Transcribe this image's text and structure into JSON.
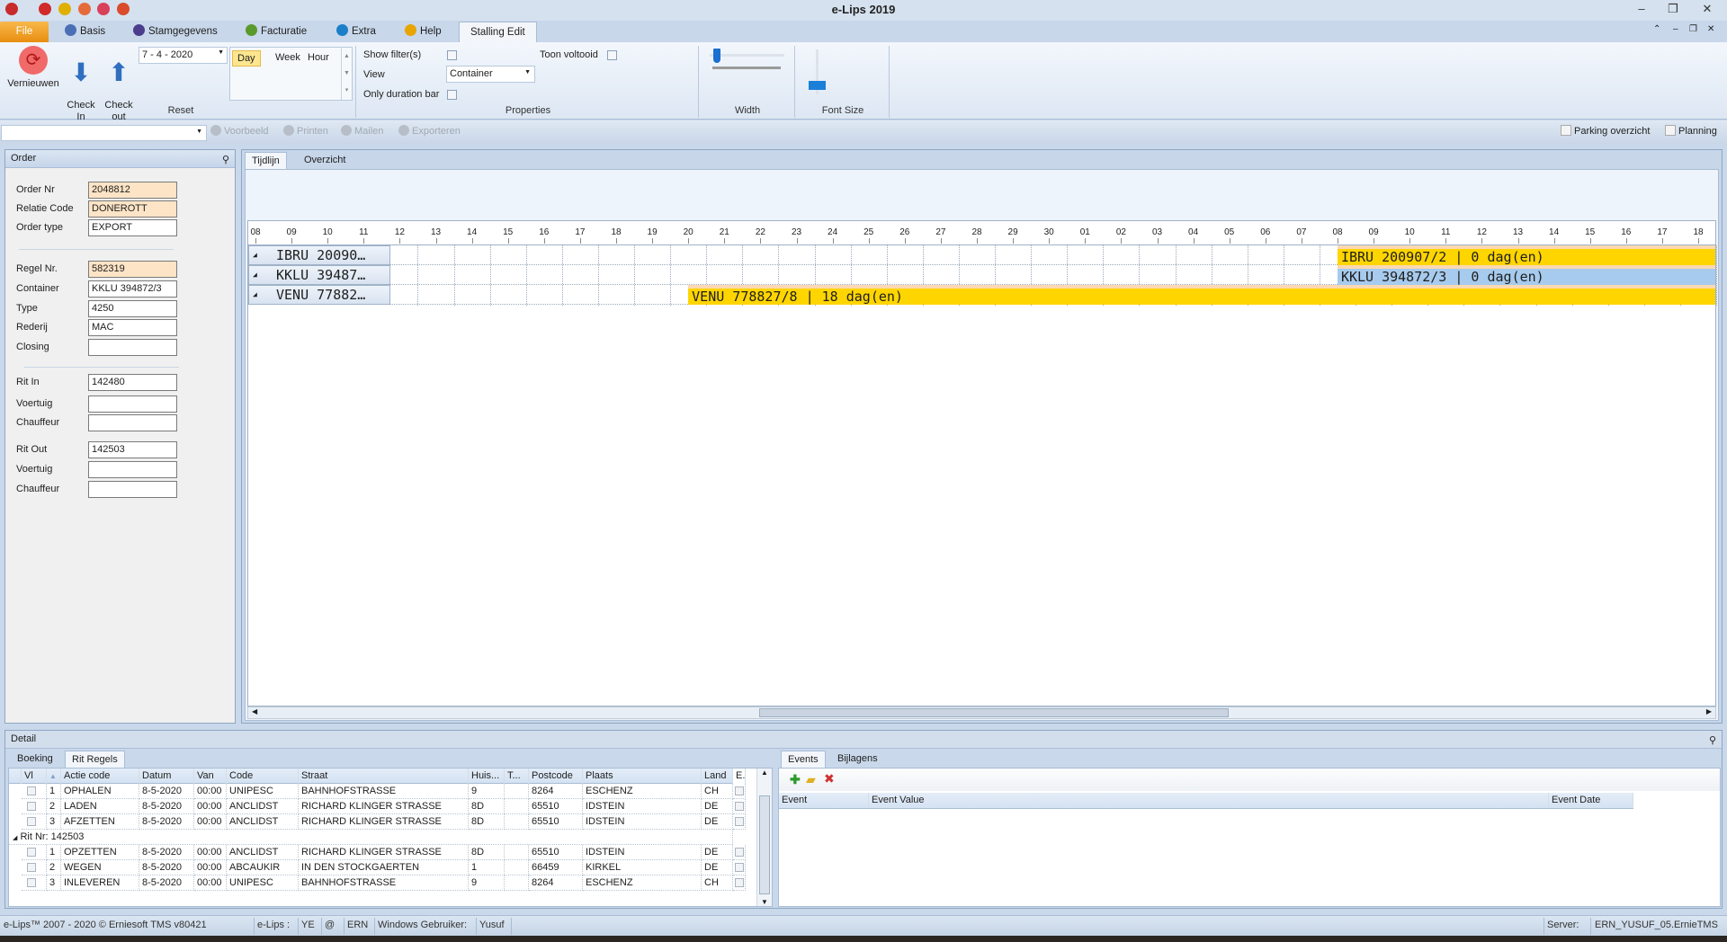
{
  "window": {
    "title": "e-Lips 2019"
  },
  "ribbon_tabs": [
    {
      "label": "File"
    },
    {
      "label": "Basis"
    },
    {
      "label": "Stamgegevens"
    },
    {
      "label": "Facturatie"
    },
    {
      "label": "Extra"
    },
    {
      "label": "Help"
    },
    {
      "label": "Stalling Edit"
    }
  ],
  "ribbon": {
    "refresh_label": "Vernieuwen",
    "check_in_label": "Check\nIn",
    "check_out_label": "Check\nout",
    "date_value": "7 -  4 - 2020",
    "scale_options": [
      "Day",
      "Week",
      "Hour"
    ],
    "scale_selected": "Day",
    "reset_group": "Reset",
    "show_filters_label": "Show filter(s)",
    "show_filters_checked": false,
    "toon_voltooid_label": "Toon voltooid",
    "toon_voltooid_checked": false,
    "view_label": "View",
    "view_value": "Container",
    "only_duration_label": "Only duration bar",
    "only_duration_checked": false,
    "properties_group": "Properties",
    "width_group": "Width",
    "font_size_group": "Font Size"
  },
  "toolbar": {
    "left": [
      "Voorbeeld",
      "Printen",
      "Mailen",
      "Exporteren"
    ],
    "right": [
      "Parking overzicht",
      "Planning"
    ]
  },
  "order": {
    "title": "Order",
    "fields": [
      {
        "label": "Order Nr",
        "value": "2048812",
        "highlight": true
      },
      {
        "label": "Relatie Code",
        "value": "DONEROTT",
        "highlight": true
      },
      {
        "label": "Order type",
        "value": "EXPORT",
        "highlight": false
      },
      {
        "label": "Regel Nr.",
        "value": "582319",
        "highlight": true
      },
      {
        "label": "Container",
        "value": "KKLU 394872/3",
        "highlight": false
      },
      {
        "label": "Type",
        "value": "4250",
        "highlight": false
      },
      {
        "label": "Rederij",
        "value": "MAC",
        "highlight": false
      },
      {
        "label": "Closing",
        "value": "",
        "highlight": false
      },
      {
        "label": "Rit In",
        "value": "142480",
        "highlight": false
      },
      {
        "label": "Voertuig",
        "value": "",
        "highlight": false
      },
      {
        "label": "Chauffeur",
        "value": "",
        "highlight": false
      },
      {
        "label": "Rit Out",
        "value": "142503",
        "highlight": false
      },
      {
        "label": "Voertuig",
        "value": "",
        "highlight": false
      },
      {
        "label": "Chauffeur",
        "value": "",
        "highlight": false
      }
    ]
  },
  "timeline": {
    "tabs": [
      "Tijdlijn",
      "Overzicht"
    ],
    "active_tab": "Tijdlijn",
    "ticks": [
      "08",
      "09",
      "10",
      "11",
      "12",
      "13",
      "14",
      "15",
      "16",
      "17",
      "18",
      "19",
      "20",
      "21",
      "22",
      "23",
      "24",
      "25",
      "26",
      "27",
      "28",
      "29",
      "30",
      "01",
      "02",
      "03",
      "04",
      "05",
      "06",
      "07",
      "08",
      "09",
      "10",
      "11",
      "12",
      "13",
      "14",
      "15",
      "16",
      "17",
      "18"
    ],
    "rows": [
      {
        "label": "IBRU 20090…",
        "bar": "IBRU 200907/2 | 0 dag(en)",
        "start_tick": 30,
        "color": "#ffd500"
      },
      {
        "label": "KKLU 39487…",
        "bar": "KKLU 394872/3 | 0 dag(en)",
        "start_tick": 30,
        "color": "#a7cbee"
      },
      {
        "label": "VENU 77882…",
        "bar": "VENU 778827/8 | 18 dag(en)",
        "start_tick": 12,
        "color": "#ffd500"
      }
    ],
    "colors": {
      "bar_top": "#fcd9b0"
    }
  },
  "detail": {
    "title": "Detail",
    "tabs": [
      "Boeking",
      "Rit Regels"
    ],
    "active_tab": "Rit Regels",
    "columns": [
      "Vl",
      "",
      "Actie code",
      "Datum",
      "Van",
      "Code",
      "Straat",
      "Huis...",
      "T...",
      "Postcode",
      "Plaats",
      "Land",
      "E..."
    ],
    "groups": [
      {
        "header": "",
        "rows": [
          [
            "1",
            "OPHALEN",
            "8-5-2020",
            "00:00",
            "UNIPESC",
            "BAHNHOFSTRASSE",
            "9",
            "",
            "8264",
            "ESCHENZ",
            "CH"
          ],
          [
            "2",
            "LADEN",
            "8-5-2020",
            "00:00",
            "ANCLIDST",
            "RICHARD KLINGER STRASSE",
            "8D",
            "",
            "65510",
            "IDSTEIN",
            "DE"
          ],
          [
            "3",
            "AFZETTEN",
            "8-5-2020",
            "00:00",
            "ANCLIDST",
            "RICHARD KLINGER STRASSE",
            "8D",
            "",
            "65510",
            "IDSTEIN",
            "DE"
          ]
        ]
      },
      {
        "header": "Rit Nr: 142503",
        "rows": [
          [
            "1",
            "OPZETTEN",
            "8-5-2020",
            "00:00",
            "ANCLIDST",
            "RICHARD KLINGER STRASSE",
            "8D",
            "",
            "65510",
            "IDSTEIN",
            "DE"
          ],
          [
            "2",
            "WEGEN",
            "8-5-2020",
            "00:00",
            "ABCAUKIR",
            "IN DEN STOCKGAERTEN",
            "1",
            "",
            "66459",
            "KIRKEL",
            "DE"
          ],
          [
            "3",
            "INLEVEREN",
            "8-5-2020",
            "00:00",
            "UNIPESC",
            "BAHNHOFSTRASSE",
            "9",
            "",
            "8264",
            "ESCHENZ",
            "CH"
          ]
        ]
      }
    ],
    "events_tabs": [
      "Events",
      "Bijlagens"
    ],
    "events_active": "Events",
    "events_columns": [
      "Event",
      "Event Value",
      "Event Date"
    ]
  },
  "status": {
    "copyright": "e-Lips™ 2007 - 2020 © Erniesoft TMS v80421",
    "items": [
      "e-Lips :",
      "YE",
      "@",
      "ERN",
      "Windows Gebruiker:",
      "Yusuf"
    ],
    "server_label": "Server:",
    "server_value": "ERN_YUSUF_05.ErnieTMS"
  }
}
